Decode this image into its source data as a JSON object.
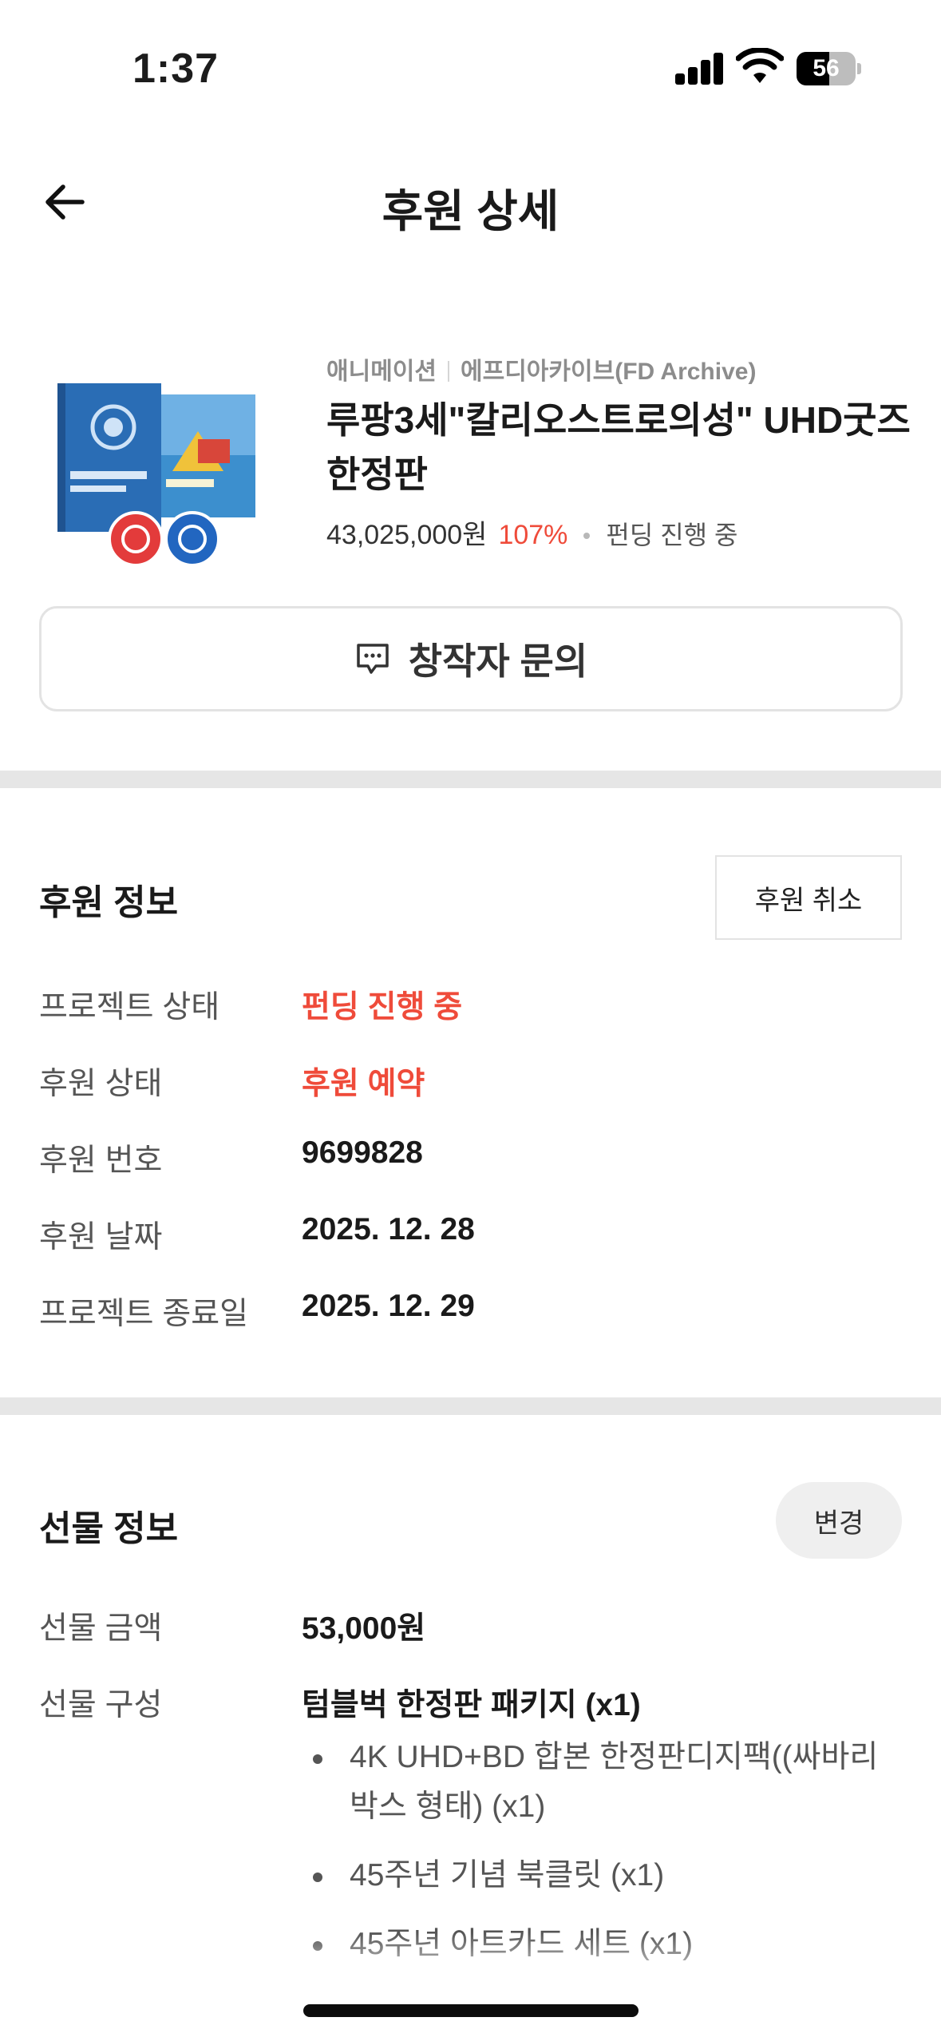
{
  "status_bar": {
    "time": "1:37",
    "battery": "56",
    "battery_level": 0.56
  },
  "header": {
    "title": "후원 상세",
    "back_icon": "arrow-left-icon"
  },
  "project": {
    "category": "애니메이션",
    "creator": "에프디아카이브(FD Archive)",
    "title_line1": "루팡3세\"칼리오스트로의성\" UHD굿즈",
    "title_line2": "한정판",
    "amount": "43,025,000원",
    "percent": "107%",
    "status": "펀딩 진행 중"
  },
  "inquiry_button": {
    "label": "창작자 문의",
    "icon": "chat-icon"
  },
  "support_info": {
    "title": "후원 정보",
    "cancel_label": "후원 취소",
    "rows": [
      {
        "label": "프로젝트 상태",
        "value": "펀딩 진행 중",
        "highlight": true
      },
      {
        "label": "후원 상태",
        "value": "후원 예약",
        "highlight": true
      },
      {
        "label": "후원 번호",
        "value": "9699828",
        "highlight": false
      },
      {
        "label": "후원 날짜",
        "value": "2025. 12. 28",
        "highlight": false
      },
      {
        "label": "프로젝트 종료일",
        "value": "2025. 12. 29",
        "highlight": false
      }
    ]
  },
  "reward_info": {
    "title": "선물 정보",
    "change_label": "변경",
    "amount_label": "선물 금액",
    "amount_value": "53,000원",
    "composition_label": "선물 구성",
    "package_name": "텀블벅 한정판 패키지 (x1)",
    "items": [
      "4K UHD+BD 합본 한정판디지팩((싸바리 박스 형태) (x1)",
      "45주년 기념 북클릿 (x1)",
      "45주년 아트카드 세트 (x1)"
    ]
  },
  "colors": {
    "accent": "#ef4b3a",
    "divider": "#e6e6e6"
  }
}
